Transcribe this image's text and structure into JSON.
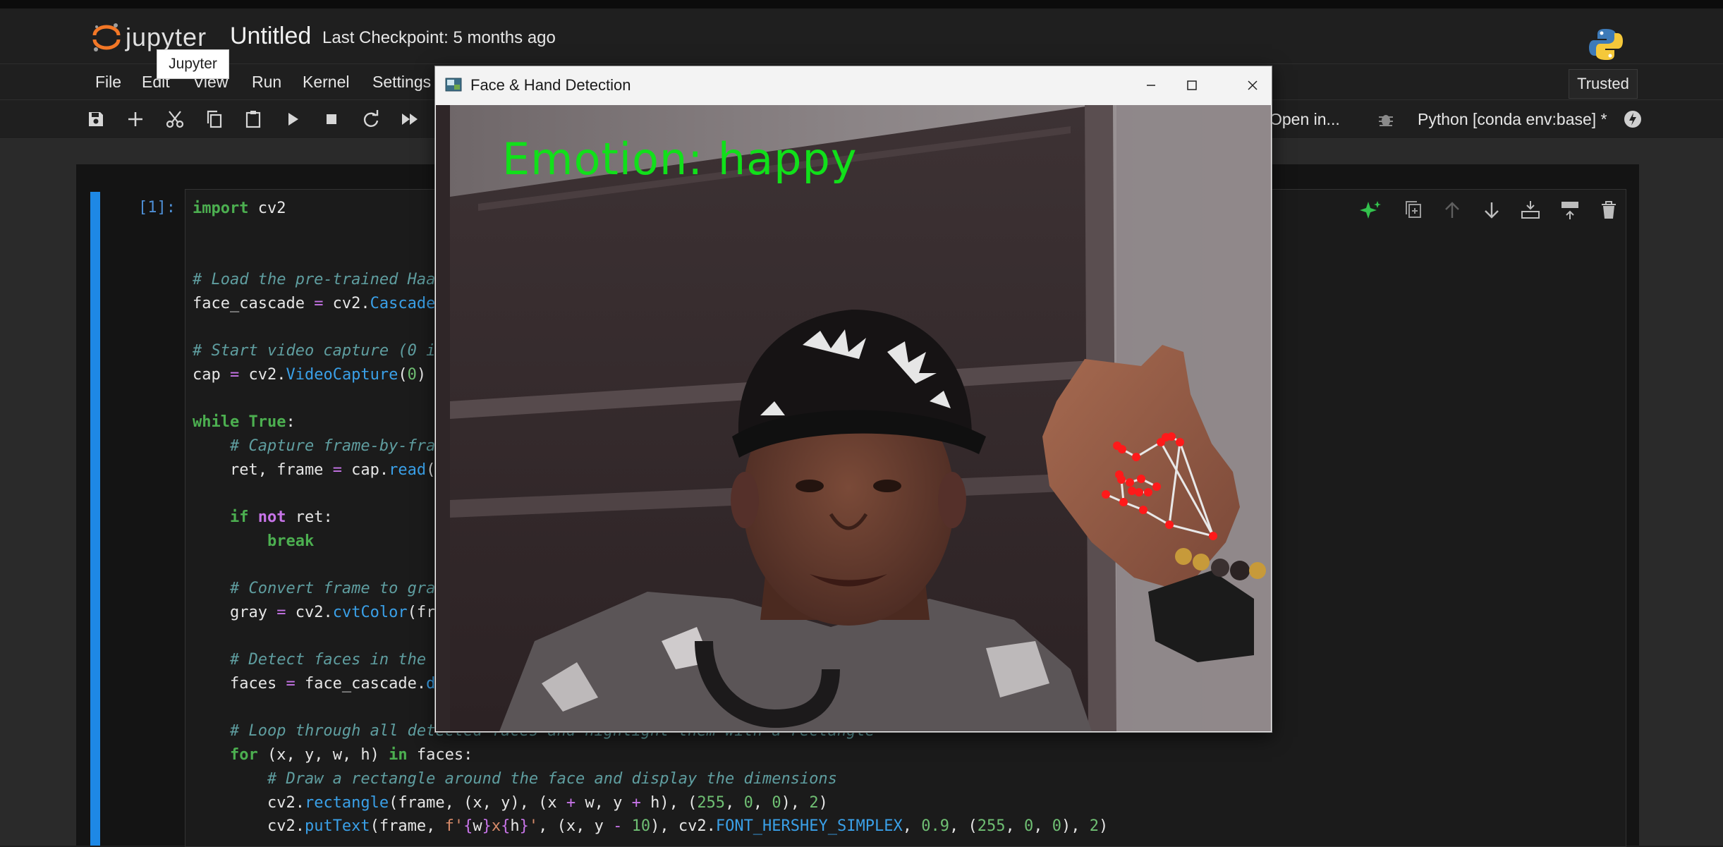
{
  "app": {
    "logo_text": "jupyter",
    "tooltip": "Jupyter"
  },
  "notebook": {
    "title": "Untitled",
    "checkpoint": "Last Checkpoint: 5 months ago",
    "trusted": "Trusted"
  },
  "menu": [
    "File",
    "Edit",
    "View",
    "Run",
    "Kernel",
    "Settings"
  ],
  "toolbar": {
    "icons": [
      "save-icon",
      "add-cell-icon",
      "cut-icon",
      "copy-icon",
      "paste-icon",
      "run-icon",
      "stop-icon",
      "restart-icon",
      "fast-forward-icon"
    ],
    "open_in": "Open in...",
    "kernel": "Python [conda env:base] *"
  },
  "cell": {
    "prompt": "[1]:",
    "tool_icons": [
      "ai-sparkle-icon",
      "duplicate-cell-icon",
      "move-up-icon",
      "move-down-icon",
      "insert-above-icon",
      "insert-below-icon",
      "delete-icon"
    ]
  },
  "cv_window": {
    "title": "Face & Hand Detection",
    "emotion_text": "Emotion: happy"
  },
  "colors": {
    "accent_blue": "#1e88e5",
    "keyword_green": "#4caf50",
    "emotion_green": "#11e01a",
    "landmark_red": "#ff1a1a"
  }
}
